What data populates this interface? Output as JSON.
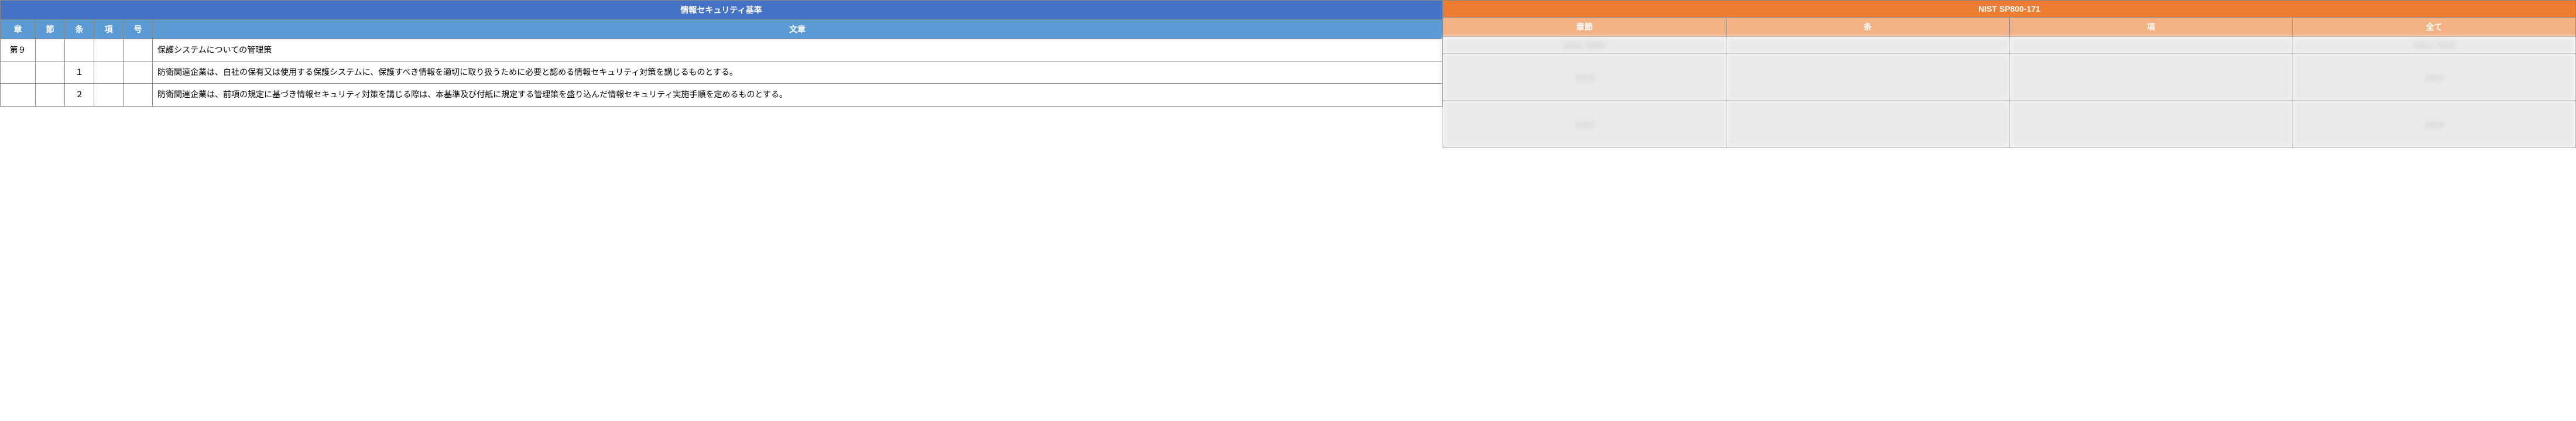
{
  "left": {
    "title": "情報セキュリティ基準",
    "headers": {
      "chapter": "章",
      "section": "節",
      "article": "条",
      "item": "項",
      "number": "号",
      "text": "文章"
    },
    "rows": [
      {
        "chapter": "第９",
        "section": "",
        "article": "",
        "item": "",
        "number": "",
        "text": "保護システムについての管理策"
      },
      {
        "chapter": "",
        "section": "",
        "article": "１",
        "item": "",
        "number": "",
        "text": "防衛関連企業は、自社の保有又は使用する保護システムに、保護すべき情報を適切に取り扱うために必要と認める情報セキュリティ対策を講じるものとする。"
      },
      {
        "chapter": "",
        "section": "",
        "article": "２",
        "item": "",
        "number": "",
        "text": "防衛関連企業は、前項の規定に基づき情報セキュリティ対策を講じる際は、本基準及び付紙に規定する管理策を盛り込んだ情報セキュリティ実施手順を定めるものとする。"
      }
    ]
  },
  "right": {
    "title": "NIST SP800-171",
    "headers": {
      "chapsec": "章節",
      "article": "条",
      "item": "項",
      "all": "全て"
    },
    "rows": [
      {
        "chapsec": "3.8.1, 3.8.9",
        "article": "",
        "item": "",
        "all": "3.8.1, 3.8.9"
      },
      {
        "chapsec": "3.8.3",
        "article": "",
        "item": "",
        "all": "3.8.3"
      },
      {
        "chapsec": "3.8.9",
        "article": "",
        "item": "",
        "all": "3.8.9"
      }
    ]
  }
}
